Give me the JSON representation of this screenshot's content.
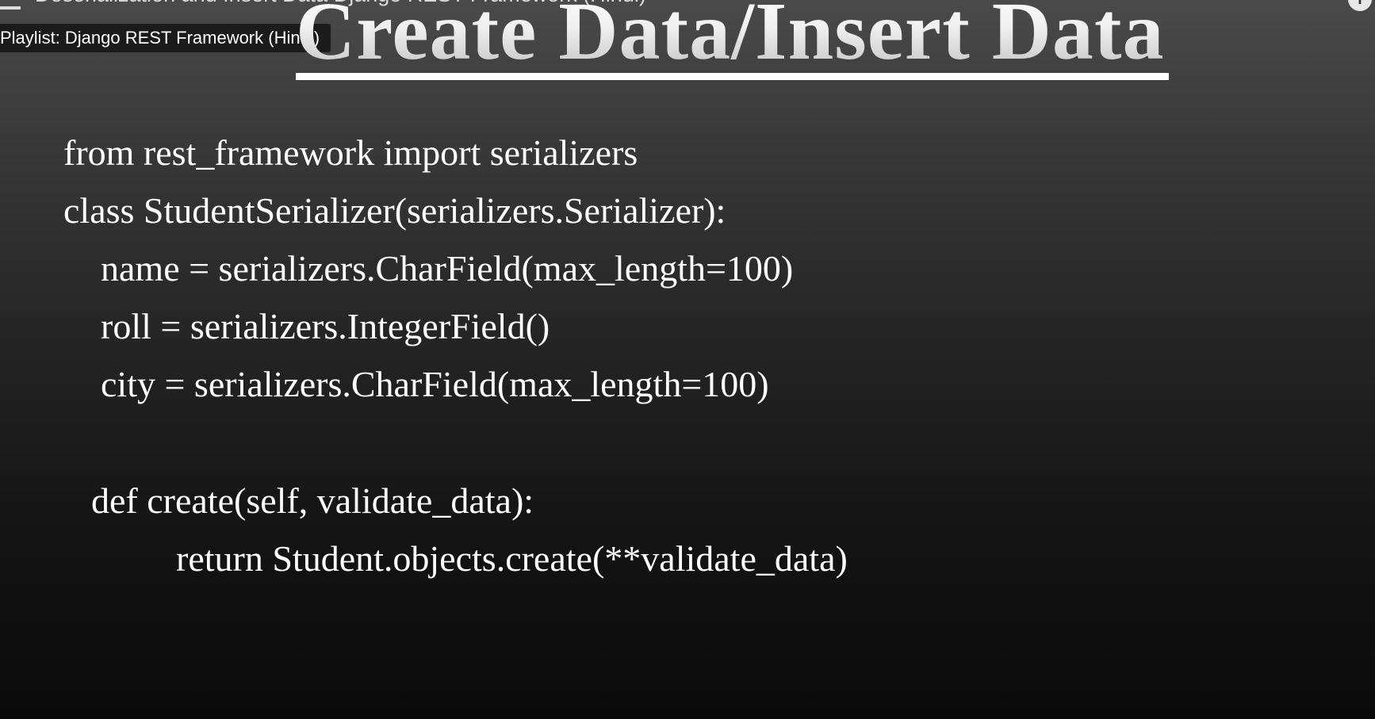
{
  "video": {
    "title": "Deserialization and Insert Data Django REST Framework (Hindi)",
    "playlist_label": "Playlist: Django REST Framework (Hindi)"
  },
  "slide": {
    "title": "Create Data/Insert Data",
    "code_lines": [
      "from rest_framework import serializers",
      "class StudentSerializer(serializers.Serializer):",
      "name = serializers.CharField(max_length=100)",
      "roll = serializers.IntegerField()",
      "city = serializers.CharField(max_length=100)",
      "def create(self, validate_data):",
      "return Student.objects.create(**validate_data)"
    ]
  },
  "icons": {
    "top_left": "playlist-icon",
    "top_right": "info-icon"
  },
  "colors": {
    "background_top": "#4a4a4a",
    "background_bottom": "#0a0a0a",
    "text": "#ffffff"
  }
}
